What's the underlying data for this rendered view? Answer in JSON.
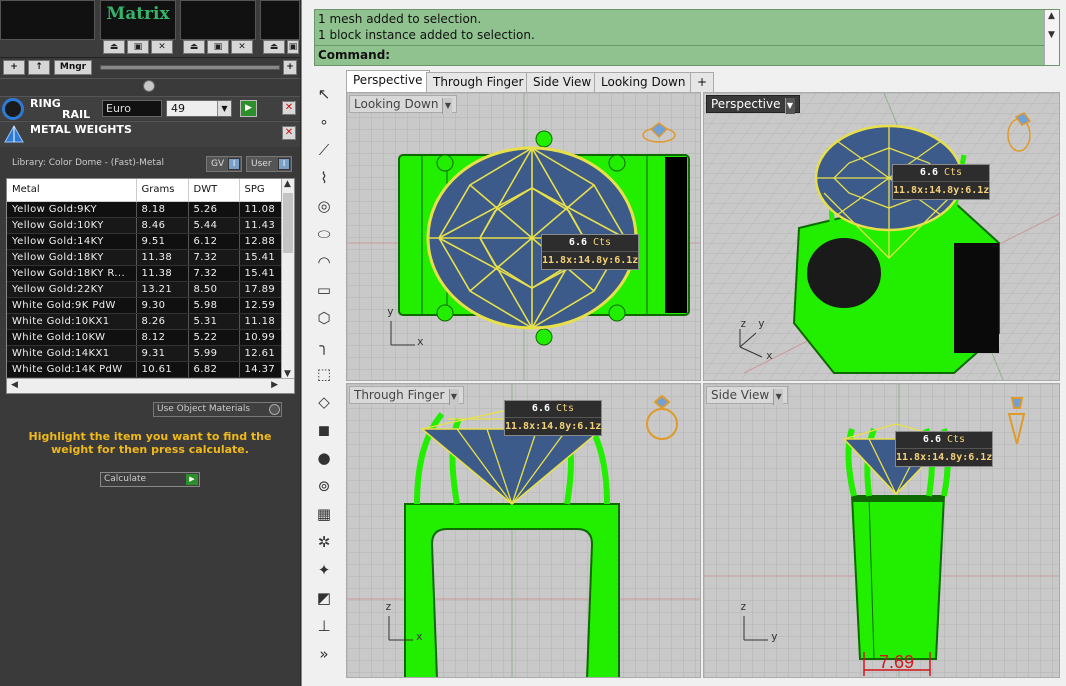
{
  "left_panel": {
    "preview_title": "Matrix",
    "nav": {
      "add": "+",
      "up": "↑",
      "manager": "Mngr",
      "add_right": "+"
    },
    "ring_rail": {
      "title_line1": "RING",
      "title_line2": "RAIL",
      "size_system": "Euro",
      "size_value": "49"
    },
    "metal_weights": {
      "title": "METAL WEIGHTS"
    },
    "library_label": "Library: Color Dome - (Fast)-Metal",
    "toggle_gv": "GV",
    "toggle_user": "User",
    "table": {
      "headers": [
        "Metal",
        "Grams",
        "DWT",
        "SPG"
      ],
      "rows": [
        [
          "Yellow Gold:9KY",
          "8.18",
          "5.26",
          "11.08"
        ],
        [
          "Yellow Gold:10KY",
          "8.46",
          "5.44",
          "11.43"
        ],
        [
          "Yellow Gold:14KY",
          "9.51",
          "6.12",
          "12.88"
        ],
        [
          "Yellow Gold:18KY",
          "11.38",
          "7.32",
          "15.41"
        ],
        [
          "Yellow Gold:18KY R...",
          "11.38",
          "7.32",
          "15.41"
        ],
        [
          "Yellow Gold:22KY",
          "13.21",
          "8.50",
          "17.89"
        ],
        [
          "White Gold:9K PdW",
          "9.30",
          "5.98",
          "12.59"
        ],
        [
          "White Gold:10KX1",
          "8.26",
          "5.31",
          "11.18"
        ],
        [
          "White Gold:10KW",
          "8.12",
          "5.22",
          "10.99"
        ],
        [
          "White Gold:14KX1",
          "9.31",
          "5.99",
          "12.61"
        ],
        [
          "White Gold:14K PdW",
          "10.61",
          "6.82",
          "14.37"
        ]
      ]
    },
    "use_object_materials": "Use Object Materials",
    "hint": "Highlight the item you want to find the weight for then press calculate.",
    "calculate": "Calculate"
  },
  "command": {
    "line1": "1 mesh added to selection.",
    "line2": "1 block instance added to selection.",
    "prompt": "Command:"
  },
  "tabs": [
    "Perspective",
    "Through Finger",
    "Side View",
    "Looking Down",
    "+"
  ],
  "viewports": {
    "top_left": "Looking Down",
    "top_right": "Perspective",
    "bottom_left": "Through Finger",
    "bottom_right": "Side View"
  },
  "gem_info": {
    "carats": "6.6",
    "cts_label": "Cts",
    "dims": "11.8x:14.8y:6.1z"
  },
  "dimension_value": "7.69",
  "colors": {
    "model_green": "#22ee00",
    "wire_yellow": "#e8e04a",
    "gem_blue": "#3c5a8a",
    "cmd_green": "#90c290"
  }
}
